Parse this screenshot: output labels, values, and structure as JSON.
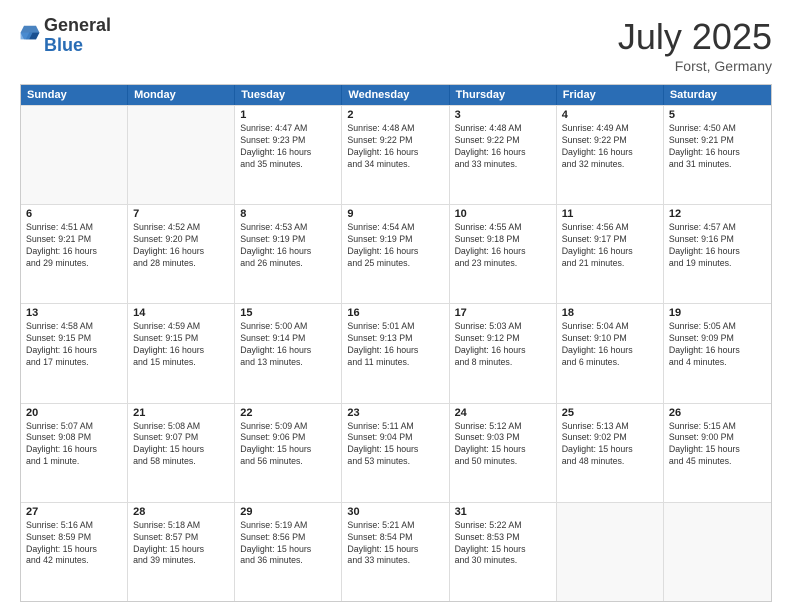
{
  "header": {
    "logo_general": "General",
    "logo_blue": "Blue",
    "month": "July 2025",
    "location": "Forst, Germany"
  },
  "days": [
    "Sunday",
    "Monday",
    "Tuesday",
    "Wednesday",
    "Thursday",
    "Friday",
    "Saturday"
  ],
  "weeks": [
    [
      {
        "day": "",
        "info": ""
      },
      {
        "day": "",
        "info": ""
      },
      {
        "day": "1",
        "info": "Sunrise: 4:47 AM\nSunset: 9:23 PM\nDaylight: 16 hours\nand 35 minutes."
      },
      {
        "day": "2",
        "info": "Sunrise: 4:48 AM\nSunset: 9:22 PM\nDaylight: 16 hours\nand 34 minutes."
      },
      {
        "day": "3",
        "info": "Sunrise: 4:48 AM\nSunset: 9:22 PM\nDaylight: 16 hours\nand 33 minutes."
      },
      {
        "day": "4",
        "info": "Sunrise: 4:49 AM\nSunset: 9:22 PM\nDaylight: 16 hours\nand 32 minutes."
      },
      {
        "day": "5",
        "info": "Sunrise: 4:50 AM\nSunset: 9:21 PM\nDaylight: 16 hours\nand 31 minutes."
      }
    ],
    [
      {
        "day": "6",
        "info": "Sunrise: 4:51 AM\nSunset: 9:21 PM\nDaylight: 16 hours\nand 29 minutes."
      },
      {
        "day": "7",
        "info": "Sunrise: 4:52 AM\nSunset: 9:20 PM\nDaylight: 16 hours\nand 28 minutes."
      },
      {
        "day": "8",
        "info": "Sunrise: 4:53 AM\nSunset: 9:19 PM\nDaylight: 16 hours\nand 26 minutes."
      },
      {
        "day": "9",
        "info": "Sunrise: 4:54 AM\nSunset: 9:19 PM\nDaylight: 16 hours\nand 25 minutes."
      },
      {
        "day": "10",
        "info": "Sunrise: 4:55 AM\nSunset: 9:18 PM\nDaylight: 16 hours\nand 23 minutes."
      },
      {
        "day": "11",
        "info": "Sunrise: 4:56 AM\nSunset: 9:17 PM\nDaylight: 16 hours\nand 21 minutes."
      },
      {
        "day": "12",
        "info": "Sunrise: 4:57 AM\nSunset: 9:16 PM\nDaylight: 16 hours\nand 19 minutes."
      }
    ],
    [
      {
        "day": "13",
        "info": "Sunrise: 4:58 AM\nSunset: 9:15 PM\nDaylight: 16 hours\nand 17 minutes."
      },
      {
        "day": "14",
        "info": "Sunrise: 4:59 AM\nSunset: 9:15 PM\nDaylight: 16 hours\nand 15 minutes."
      },
      {
        "day": "15",
        "info": "Sunrise: 5:00 AM\nSunset: 9:14 PM\nDaylight: 16 hours\nand 13 minutes."
      },
      {
        "day": "16",
        "info": "Sunrise: 5:01 AM\nSunset: 9:13 PM\nDaylight: 16 hours\nand 11 minutes."
      },
      {
        "day": "17",
        "info": "Sunrise: 5:03 AM\nSunset: 9:12 PM\nDaylight: 16 hours\nand 8 minutes."
      },
      {
        "day": "18",
        "info": "Sunrise: 5:04 AM\nSunset: 9:10 PM\nDaylight: 16 hours\nand 6 minutes."
      },
      {
        "day": "19",
        "info": "Sunrise: 5:05 AM\nSunset: 9:09 PM\nDaylight: 16 hours\nand 4 minutes."
      }
    ],
    [
      {
        "day": "20",
        "info": "Sunrise: 5:07 AM\nSunset: 9:08 PM\nDaylight: 16 hours\nand 1 minute."
      },
      {
        "day": "21",
        "info": "Sunrise: 5:08 AM\nSunset: 9:07 PM\nDaylight: 15 hours\nand 58 minutes."
      },
      {
        "day": "22",
        "info": "Sunrise: 5:09 AM\nSunset: 9:06 PM\nDaylight: 15 hours\nand 56 minutes."
      },
      {
        "day": "23",
        "info": "Sunrise: 5:11 AM\nSunset: 9:04 PM\nDaylight: 15 hours\nand 53 minutes."
      },
      {
        "day": "24",
        "info": "Sunrise: 5:12 AM\nSunset: 9:03 PM\nDaylight: 15 hours\nand 50 minutes."
      },
      {
        "day": "25",
        "info": "Sunrise: 5:13 AM\nSunset: 9:02 PM\nDaylight: 15 hours\nand 48 minutes."
      },
      {
        "day": "26",
        "info": "Sunrise: 5:15 AM\nSunset: 9:00 PM\nDaylight: 15 hours\nand 45 minutes."
      }
    ],
    [
      {
        "day": "27",
        "info": "Sunrise: 5:16 AM\nSunset: 8:59 PM\nDaylight: 15 hours\nand 42 minutes."
      },
      {
        "day": "28",
        "info": "Sunrise: 5:18 AM\nSunset: 8:57 PM\nDaylight: 15 hours\nand 39 minutes."
      },
      {
        "day": "29",
        "info": "Sunrise: 5:19 AM\nSunset: 8:56 PM\nDaylight: 15 hours\nand 36 minutes."
      },
      {
        "day": "30",
        "info": "Sunrise: 5:21 AM\nSunset: 8:54 PM\nDaylight: 15 hours\nand 33 minutes."
      },
      {
        "day": "31",
        "info": "Sunrise: 5:22 AM\nSunset: 8:53 PM\nDaylight: 15 hours\nand 30 minutes."
      },
      {
        "day": "",
        "info": ""
      },
      {
        "day": "",
        "info": ""
      }
    ]
  ]
}
